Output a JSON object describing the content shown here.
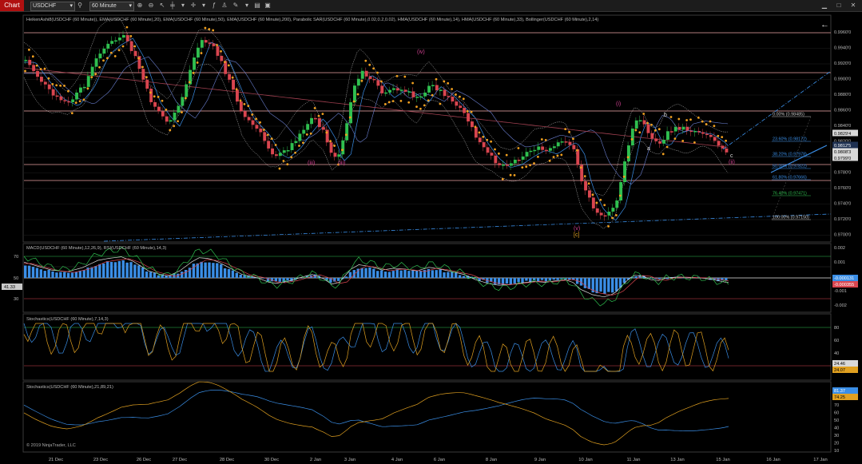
{
  "window": {
    "tab": "Chart",
    "instrument": "USDCHF",
    "interval": "60 Minute",
    "back_arrow": "←"
  },
  "toolbar_icons": [
    "instrument-dropdown-icon",
    "interval-dropdown-icon",
    "magnify-icon",
    "zoom-in-icon",
    "pointer-icon",
    "crosshair-icon",
    "zoom-out-icon",
    "indicators-icon",
    "drawing-tools-icon",
    "templates-icon",
    "properties-icon",
    "minimize-icon",
    "maximize-icon",
    "close-icon"
  ],
  "price_panel": {
    "title": "HeikenAshi8(USDCHF (60 Minute)), EMA(USDCHF (60 Minute),20), EMA(USDCHF (60 Minute),50), EMA(USDCHF (60 Minute),200), Parabolic SAR(USDCHF (60 Minute),0.02,0.2,0.02), HMA(USDCHF (60 Minute),14), HMA(USDCHF (60 Minute),33), Bollinger(USDCHF (60 Minute),2,14)",
    "axis": [
      "0.9960'0",
      "0.9940'0",
      "0.9920'0",
      "0.9900'0",
      "0.9880'0",
      "0.9860'0",
      "0.9840'0",
      "0.9820'0",
      "0.9800'0",
      "0.9780'0",
      "0.9760'0",
      "0.9740'0",
      "0.9720'0",
      "0.9700'0"
    ],
    "price_tags": {
      "last": "0.9812'5",
      "other": "0.9829'4",
      "low": "0.9799'0",
      "mid": "0.9808'3"
    },
    "wave_labels": {
      "iv": "(iv)",
      "iii_a": "(iii)",
      "iii_b": "(iii)",
      "i": "(i)",
      "ii": "(ii)",
      "v": "(v)",
      "c_bracket": "[c]",
      "a": "a",
      "b": "b",
      "c": "c"
    },
    "fib_levels": [
      "0.00% (0.98485)",
      "23.60% (0.98172)",
      "38.20% (0.97978)",
      "50.00% (0.97822)",
      "61.80% (0.97666)",
      "76.40% (0.97471)",
      "100.00% (0.97150)"
    ],
    "fib_colors": [
      "#cccccc",
      "#3a8ee6",
      "#3a8ee6",
      "#3a8ee6",
      "#3a8ee6",
      "#2fbf4f",
      "#cccccc"
    ]
  },
  "macd_panel": {
    "title": "MACD(USDCHF (60 Minute),12,26,9), RSI(USDCHF (60 Minute),14,3)",
    "left_axis": [
      "70",
      "50",
      "30"
    ],
    "right_axis": [
      "0.002",
      "0.001",
      "0",
      "-0.001",
      "-0.002"
    ],
    "rsi_tag": "41.33",
    "macd_tag": "-0.000131",
    "macd_tag2": "-0.000355"
  },
  "stoch1_panel": {
    "title": "Stochastics(USDCHF (60 Minute),7,14,3)",
    "axis": [
      "80",
      "60",
      "40",
      "20"
    ],
    "tag_a": "24.46",
    "tag_b": "24.07"
  },
  "stoch2_panel": {
    "title": "Stochastics(USDCHF (60 Minute),21,89,21)",
    "axis": [
      "70",
      "60",
      "50",
      "40",
      "30",
      "20",
      "10"
    ],
    "tag_a": "81.37",
    "tag_b": "74.25",
    "copyright": "© 2019 NinjaTrader, LLC"
  },
  "x_axis": [
    "21 Dec",
    "23 Dec",
    "26 Dec",
    "27 Dec",
    "28 Dec",
    "30 Dec",
    "2 Jan",
    "3 Jan",
    "4 Jan",
    "6 Jan",
    "8 Jan",
    "9 Jan",
    "10 Jan",
    "11 Jan",
    "13 Jan",
    "15 Jan",
    "16 Jan",
    "17 Jan"
  ],
  "colors": {
    "bull": "#2fbf4f",
    "bear": "#d9454f",
    "sar": "#f0a020",
    "ema20": "#3a8ee6",
    "ema200": "#a04050",
    "hline": "#e8a0a0",
    "trend": "#3a8ee6",
    "panel_border": "#444",
    "grid": "#2a2a2a"
  }
}
